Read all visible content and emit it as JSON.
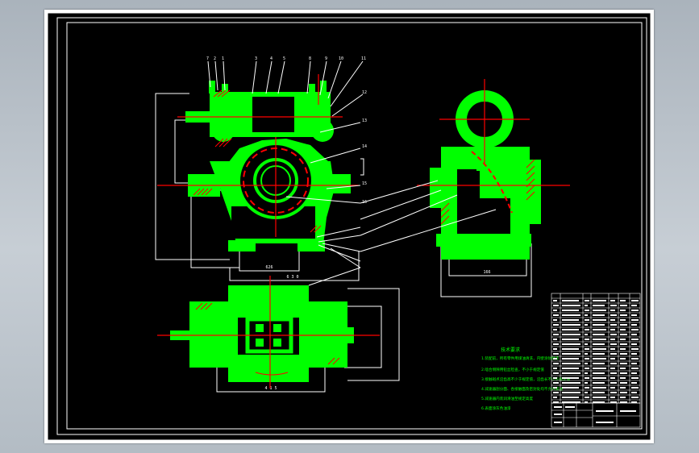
{
  "drawing": {
    "background": "#000000",
    "frame_color": "#ffffff",
    "part_color": "#00ff00",
    "centerline_color": "#ff0000",
    "dimension_color": "#ffffff"
  },
  "front_view": {
    "leader_numbers": [
      "7",
      "2",
      "1",
      "3",
      "4",
      "5",
      "8",
      "9",
      "10",
      "11",
      "12",
      "13",
      "14",
      "15",
      "16"
    ],
    "dimensions": {
      "bottom_width": "626",
      "base_width": "6 3 0"
    }
  },
  "side_view": {
    "dimensions": {
      "bottom_width": "166"
    }
  },
  "top_view": {
    "dimensions": {
      "bottom_width": "4 1 5"
    }
  },
  "notes": {
    "title": "技术要求",
    "lines": [
      "1.装配前，所有零件用煤油清洗，内壁涂防锈漆",
      "2.啮合侧隙用铅丝检查，不小于规定值",
      "3.接触斑点沿齿高不少于规定值，沿齿长不少于规定值",
      "4.减速器剖分面、各接触面及密封处均不允许漏油",
      "5.减速器内装润滑油至规定高度",
      "6.表面涂灰色油漆"
    ]
  }
}
